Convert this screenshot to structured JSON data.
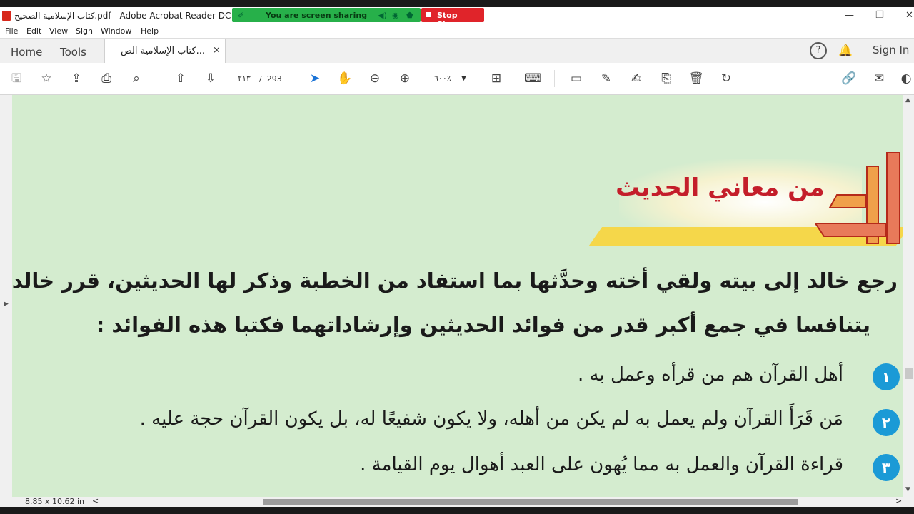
{
  "window": {
    "title": "كتاب الإسلامية الصحيح.pdf - Adobe Acrobat Reader DC (64-bit)",
    "minimize": "—",
    "restore": "❐",
    "close": "✕"
  },
  "screen_share": {
    "status_text": "You are screen sharing",
    "stop_label": "Stop Share"
  },
  "menu": [
    "File",
    "Edit",
    "View",
    "Sign",
    "Window",
    "Help"
  ],
  "tabs": {
    "home": "Home",
    "tools": "Tools",
    "document": "كتاب الإسلامية الص...",
    "close": "×",
    "help": "?",
    "notifications": "🔔",
    "sign_in": "Sign In"
  },
  "toolbar": {
    "current_page": "٢١٣",
    "page_separator": "/",
    "total_pages": "293",
    "zoom": "٦٠٠٪"
  },
  "document": {
    "heading": "من معاني الحديث",
    "paragraph_line1": "رجع خالد إلى بيته ولقي أخته وحدَّثها بما استفاد من الخطبة وذكر لها الحديثين، قرر خالد وأخته",
    "paragraph_line2": "يتنافسا في جمع أكبر قدر من فوائد الحديثين وإرشاداتهما فكتبا هذه الفوائد :",
    "items": [
      {
        "number": "١",
        "text": "أهل القرآن هم من قرأه وعمل به ."
      },
      {
        "number": "٢",
        "text": "مَن قَرَأَ القرآن ولم يعمل به لم يكن من أهله، ولا يكون شفيعًا له، بل يكون القرآن حجة عليه ."
      },
      {
        "number": "٣",
        "text": "قراءة القرآن والعمل به مما يُهون على العبد أهوال يوم القيامة ."
      }
    ]
  },
  "status": {
    "page_size": "8.85 x 10.62 in",
    "scroll_left": "<",
    "scroll_right": ">"
  },
  "colors": {
    "page_background": "#d4eccf",
    "heading_red": "#c41e2a",
    "bullet_blue": "#1b9ad6",
    "share_green": "#27b04a",
    "stop_red": "#e0242a"
  }
}
